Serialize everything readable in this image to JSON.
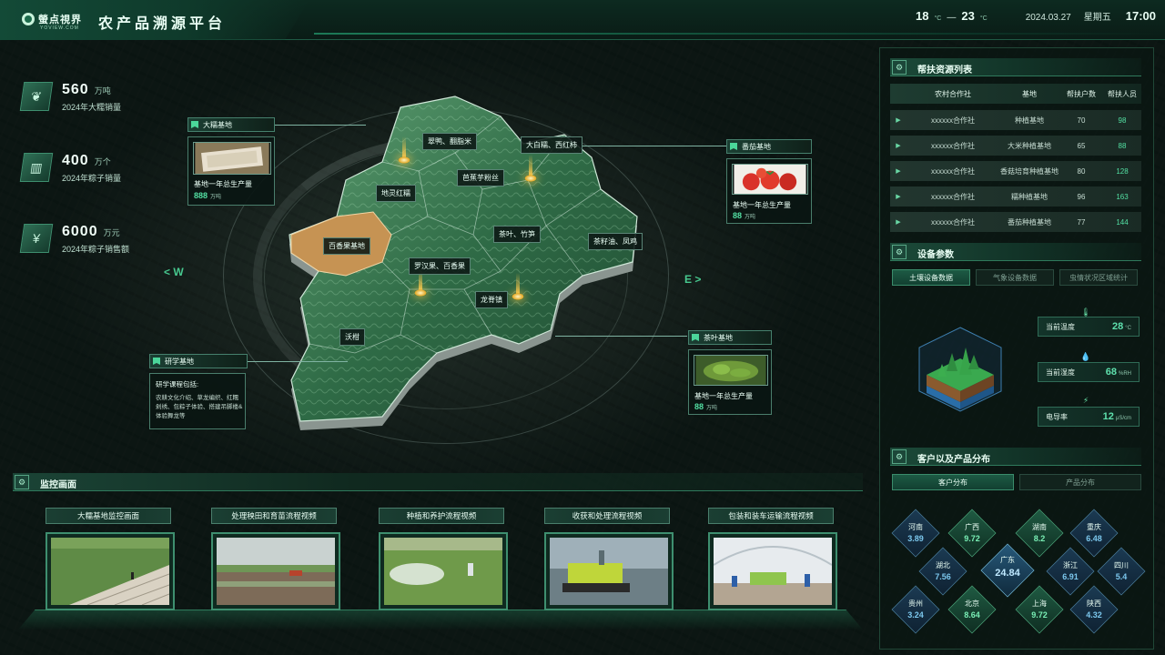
{
  "header": {
    "logo_text": "螢点視界",
    "logo_sub": "YOVIEW.COM",
    "title": "农产品溯源平台",
    "temp_low": "18",
    "temp_high": "23",
    "temp_unit": "°C",
    "temp_sep": "—",
    "date": "2024.03.27",
    "weekday": "星期五",
    "time": "17:00"
  },
  "stats": [
    {
      "value": "560",
      "unit": "万吨",
      "label": "2024年大糯销量",
      "icon": "leaf-icon"
    },
    {
      "value": "400",
      "unit": "万个",
      "label": "2024年粽子销量",
      "icon": "bar-chart-icon"
    },
    {
      "value": "6000",
      "unit": "万元",
      "label": "2024年粽子销售额",
      "icon": "money-bag-icon"
    }
  ],
  "compass": {
    "west": "< W",
    "east": "E >"
  },
  "map_labels": {
    "l1": "翠鸭、翻脂米",
    "l2": "大白糯、西红柿",
    "l3": "芭蕉芋粉丝",
    "l4": "地灵红糯",
    "l5": "百香果基地",
    "l6": "茶叶、竹笋",
    "l7": "茶籽油、凤鸡",
    "l8": "罗汉果、百香果",
    "l9": "龙脊镇",
    "l10": "沃柑"
  },
  "callouts": {
    "rice": {
      "tag": "大糯基地",
      "caption": "基地一年总生产量",
      "value": "888",
      "unit": "万吨"
    },
    "tomato": {
      "tag": "番茄基地",
      "caption": "基地一年总生产量",
      "value": "88",
      "unit": "万吨"
    },
    "tea": {
      "tag": "茶叶基地",
      "caption": "基地一年总生产量",
      "value": "88",
      "unit": "万吨"
    },
    "study": {
      "tag": "研学基地",
      "heading": "研学课程包括:",
      "body": "农耕文化介绍、草龙编织、红糯剁绣、包粽子体验、搭建吊脚楼&体验舞龙等"
    }
  },
  "support": {
    "title": "帮扶资源列表",
    "columns": [
      "农村合作社",
      "基地",
      "帮扶户数",
      "帮扶人员"
    ],
    "rows": [
      [
        "xxxxxx合作社",
        "种植基地",
        "70",
        "98"
      ],
      [
        "xxxxxx合作社",
        "大米种植基地",
        "65",
        "88"
      ],
      [
        "xxxxxx合作社",
        "香菇培育种植基地",
        "80",
        "128"
      ],
      [
        "xxxxxx合作社",
        "糯种植基地",
        "96",
        "163"
      ],
      [
        "xxxxxx合作社",
        "番茄种植基地",
        "77",
        "144"
      ]
    ]
  },
  "device": {
    "title": "设备参数",
    "tabs": [
      "土壤设备数据",
      "气象设备数据",
      "虫情状况区域统计"
    ],
    "metrics": [
      {
        "label": "当前温度",
        "value": "28",
        "unit": "°C",
        "icon": "thermometer-icon"
      },
      {
        "label": "当前湿度",
        "value": "68",
        "unit": "%RH",
        "icon": "droplet-icon"
      },
      {
        "label": "电导率",
        "value": "12",
        "unit": "μS/cm",
        "icon": "lightning-icon"
      }
    ]
  },
  "customers": {
    "title": "客户以及产品分布",
    "tabs": [
      "客户分布",
      "产品分布"
    ],
    "regions": [
      {
        "name": "河南",
        "value": "3.89"
      },
      {
        "name": "广西",
        "value": "9.72"
      },
      {
        "name": "湖南",
        "value": "8.2"
      },
      {
        "name": "重庆",
        "value": "6.48"
      },
      {
        "name": "湖北",
        "value": "7.56"
      },
      {
        "name": "广东",
        "value": "24.84"
      },
      {
        "name": "浙江",
        "value": "6.91"
      },
      {
        "name": "四川",
        "value": "5.4"
      },
      {
        "name": "贵州",
        "value": "3.24"
      },
      {
        "name": "北京",
        "value": "8.64"
      },
      {
        "name": "上海",
        "value": "9.72"
      },
      {
        "name": "陕西",
        "value": "4.32"
      }
    ]
  },
  "monitor": {
    "title": "监控画面",
    "videos": [
      "大糯基地监控画面",
      "处理秧田和育苗流程视频",
      "种植和养护流程视频",
      "收获和处理流程视频",
      "包装和装车运输流程视频"
    ]
  },
  "colors": {
    "accent": "#53e0a3",
    "panel": "#12231d",
    "region_blue": "#1b3a52",
    "region_green": "#1f5a42"
  }
}
